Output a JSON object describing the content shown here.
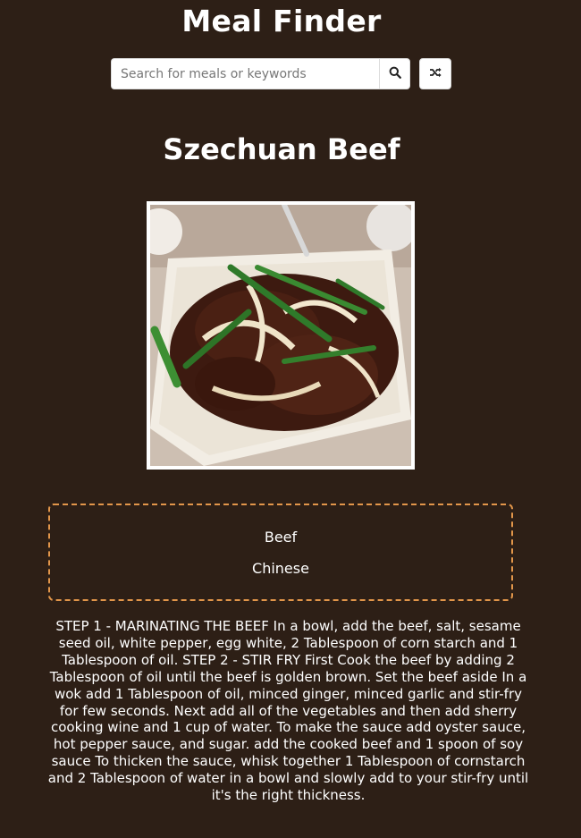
{
  "header": {
    "title": "Meal Finder"
  },
  "search": {
    "placeholder": "Search for meals or keywords",
    "value": "",
    "search_icon": "search-icon",
    "random_icon": "shuffle-icon"
  },
  "meal": {
    "name": "Szechuan Beef",
    "image_alt": "Szechuan Beef",
    "category": "Beef",
    "area": "Chinese",
    "instructions": "STEP 1 - MARINATING THE BEEF In a bowl, add the beef, salt, sesame seed oil, white pepper, egg white, 2 Tablespoon of corn starch and 1 Tablespoon of oil. STEP 2 - STIR FRY First Cook the beef by adding 2 Tablespoon of oil until the beef is golden brown. Set the beef aside In a wok add 1 Tablespoon of oil, minced ginger, minced garlic and stir-fry for few seconds. Next add all of the vegetables and then add sherry cooking wine and 1 cup of water. To make the sauce add oyster sauce, hot pepper sauce, and sugar. add the cooked beef and 1 spoon of soy sauce To thicken the sauce, whisk together 1 Tablespoon of cornstarch and 2 Tablespoon of water in a bowl and slowly add to your stir-fry until it's the right thickness."
  },
  "colors": {
    "background": "#2d1f16",
    "text": "#ffffff",
    "box_border": "#e2964a"
  }
}
